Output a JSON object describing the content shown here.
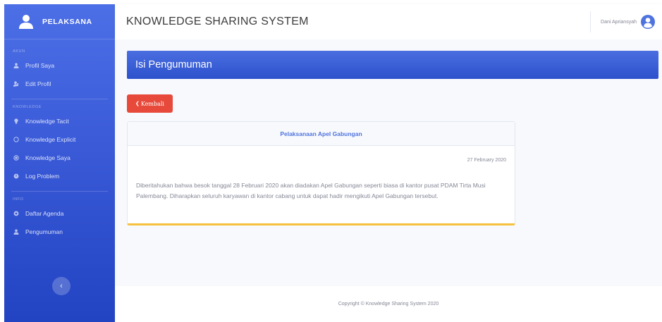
{
  "brand": {
    "name": "PELAKSANA"
  },
  "sidebar": {
    "sections": [
      {
        "heading": "AKUN",
        "items": [
          {
            "label": "Profil Saya",
            "icon": "user-icon"
          },
          {
            "label": "Edit Profil",
            "icon": "user-edit-icon"
          }
        ]
      },
      {
        "heading": "KNOWLEDGE",
        "items": [
          {
            "label": "Knowledge Tacit",
            "icon": "lightbulb-icon"
          },
          {
            "label": "Knowledge Explicit",
            "icon": "circle-icon"
          },
          {
            "label": "Knowledge Saya",
            "icon": "book-icon"
          },
          {
            "label": "Log Problem",
            "icon": "warning-icon"
          }
        ]
      },
      {
        "heading": "INFO",
        "items": [
          {
            "label": "Daftar Agenda",
            "icon": "calendar-icon"
          },
          {
            "label": "Pengumuman",
            "icon": "megaphone-icon"
          }
        ]
      }
    ],
    "toggle_icon": "chevron-left-icon"
  },
  "topbar": {
    "title": "KNOWLEDGE SHARING SYSTEM",
    "user_name": "Dani Apriansyah",
    "user_icon": "user-circle-icon"
  },
  "main": {
    "header_title": "Isi Pengumuman",
    "back_label": "Kembali",
    "announcement": {
      "title": "Pelaksanaan Apel Gabungan",
      "date": "27 February 2020",
      "body": "Diberitahukan bahwa besok tanggal 28 Februari 2020 akan diadakan Apel Gabungan seperti biasa di kantor pusat PDAM Tirta Musi Palembang. Diharapkan seluruh karyawan di kantor cabang untuk dapat hadir mengikuti Apel Gabungan tersebut."
    }
  },
  "footer": {
    "copyright": "Copyright © Knowledge Sharing System 2020"
  },
  "colors": {
    "primary": "#4e73df",
    "danger": "#e74a3b",
    "warning": "#f6c23e",
    "muted": "#858796"
  }
}
